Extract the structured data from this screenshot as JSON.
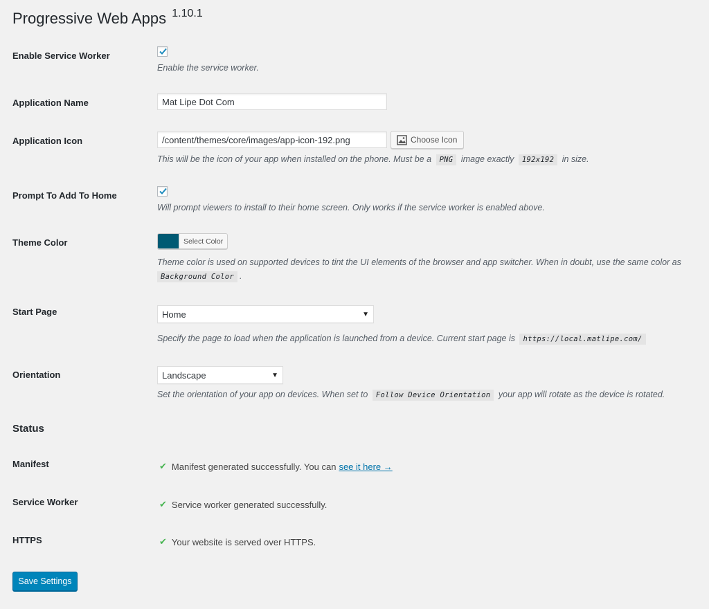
{
  "page": {
    "title": "Progressive Web Apps",
    "version": "1.10.1"
  },
  "settings": {
    "service_worker": {
      "label": "Enable Service Worker",
      "checked": true,
      "description": "Enable the service worker."
    },
    "app_name": {
      "label": "Application Name",
      "value": "Mat Lipe Dot Com"
    },
    "app_icon": {
      "label": "Application Icon",
      "value": "/content/themes/core/images/app-icon-192.png",
      "button": "Choose Icon",
      "desc_1": "This will be the icon of your app when installed on the phone. Must be a",
      "code_1": "PNG",
      "desc_2": "image exactly",
      "code_2": "192x192",
      "desc_3": "in size."
    },
    "prompt_home": {
      "label": "Prompt To Add To Home",
      "checked": true,
      "description": "Will prompt viewers to install to their home screen. Only works if the service worker is enabled above."
    },
    "theme_color": {
      "label": "Theme Color",
      "color": "#005a73",
      "button": "Select Color",
      "desc_1": "Theme color is used on supported devices to tint the UI elements of the browser and app switcher. When in doubt, use the same color as",
      "code_1": "Background Color",
      "desc_2": "."
    },
    "start_page": {
      "label": "Start Page",
      "value": "Home",
      "desc_1": "Specify the page to load when the application is launched from a device. Current start page is",
      "code_1": "https://local.matlipe.com/"
    },
    "orientation": {
      "label": "Orientation",
      "value": "Landscape",
      "desc_1": "Set the orientation of your app on devices. When set to",
      "code_1": "Follow Device Orientation",
      "desc_2": "your app will rotate as the device is rotated."
    }
  },
  "status": {
    "title": "Status",
    "manifest": {
      "label": "Manifest",
      "text": "Manifest generated successfully. You can",
      "link": "see it here →"
    },
    "service_worker": {
      "label": "Service Worker",
      "text": "Service worker generated successfully."
    },
    "https": {
      "label": "HTTPS",
      "text": "Your website is served over HTTPS."
    }
  },
  "actions": {
    "save": "Save Settings"
  },
  "colors": {
    "primary_button": "#0085ba",
    "success_check": "#46b450",
    "link": "#0073aa"
  },
  "icons": {
    "checkmark": "check-icon",
    "image": "image-icon",
    "dropdown": "chevron-down-icon",
    "status_ok": "success-check-icon"
  }
}
